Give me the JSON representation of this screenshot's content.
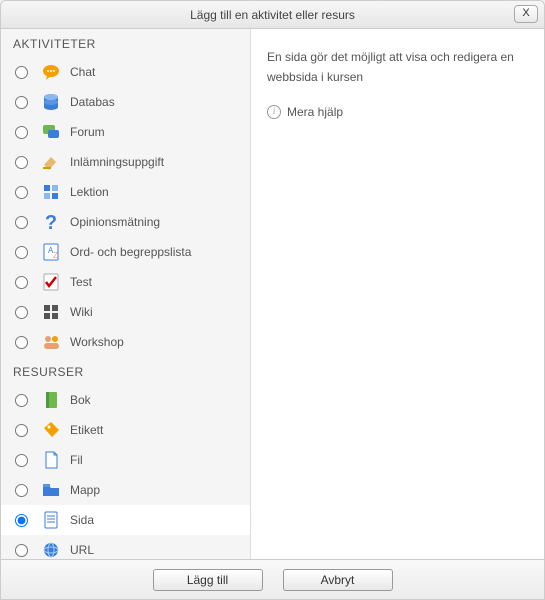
{
  "dialog": {
    "title": "Lägg till en aktivitet eller resurs",
    "close_label": "X"
  },
  "sections": {
    "activities_header": "AKTIVITETER",
    "resources_header": "RESURSER"
  },
  "activities": [
    {
      "label": "Chat",
      "icon": "chat-icon"
    },
    {
      "label": "Databas",
      "icon": "database-icon"
    },
    {
      "label": "Forum",
      "icon": "forum-icon"
    },
    {
      "label": "Inlämningsuppgift",
      "icon": "assignment-icon"
    },
    {
      "label": "Lektion",
      "icon": "lesson-icon"
    },
    {
      "label": "Opinionsmätning",
      "icon": "question-icon"
    },
    {
      "label": "Ord- och begreppslista",
      "icon": "glossary-icon"
    },
    {
      "label": "Test",
      "icon": "quiz-icon"
    },
    {
      "label": "Wiki",
      "icon": "wiki-icon"
    },
    {
      "label": "Workshop",
      "icon": "workshop-icon"
    }
  ],
  "resources": [
    {
      "label": "Bok",
      "icon": "book-icon"
    },
    {
      "label": "Etikett",
      "icon": "label-icon"
    },
    {
      "label": "Fil",
      "icon": "file-icon"
    },
    {
      "label": "Mapp",
      "icon": "folder-icon"
    },
    {
      "label": "Sida",
      "icon": "page-icon",
      "selected": true
    },
    {
      "label": "URL",
      "icon": "url-icon"
    }
  ],
  "description": "En sida gör det möjligt att visa och redigera en webbsida i kursen",
  "help_label": "Mera hjälp",
  "buttons": {
    "add": "Lägg till",
    "cancel": "Avbryt"
  }
}
